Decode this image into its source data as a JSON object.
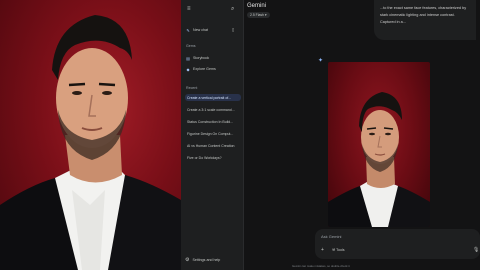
{
  "sidebar": {
    "new_chat": "New chat",
    "gems_header": "Gems",
    "gems": [
      "Storybook",
      "Explore Gems"
    ],
    "recent_header": "Recent",
    "recent": [
      "Create a vertical portrait of...",
      "Create a 3:1 scale command...",
      "Status Construction In Build...",
      "Figurine Design On Comput...",
      "AI vs Human Content Creation",
      "Five or Do Workdays?"
    ],
    "settings": "Settings and help"
  },
  "main": {
    "title": "Gemini",
    "model": "2.5 Flash",
    "message": "...to the exact same face features, characterized by stark cinematic lighting and intense contrast. Captured in a...",
    "input_placeholder": "Ask Gemini",
    "tools_label": "Tools",
    "disclaimer": "Gemini can make mistakes, so double-check it"
  },
  "colors": {
    "accent": "#a8c7fa",
    "background": "#131314",
    "sidebar": "#1e1f20",
    "photo_bg": "#7a0f18"
  }
}
